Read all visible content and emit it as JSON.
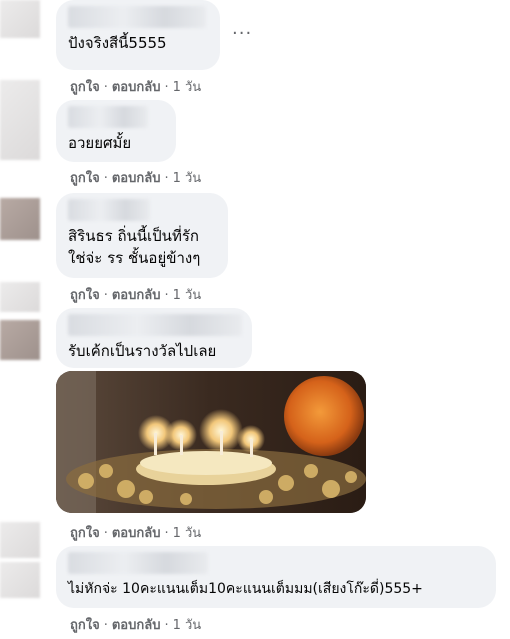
{
  "comments": [
    {
      "text_lines": [
        "ปังจริงสีนี้5555"
      ]
    },
    {
      "text_lines": [
        "อวยยศมั้ย"
      ]
    },
    {
      "text_lines": [
        "สิรินธร ถิ่นนี้เป็นที่รัก",
        "ใช่จ่ะ รร ชั้นอยู่ข้างๆ"
      ]
    },
    {
      "text_lines": [
        "รับเค้กเป็นรางวัลไปเลย"
      ]
    },
    {
      "text_lines": [
        "ไม่หักจ่ะ 10คะแนนเต็ม10คะแนนเต็มมม(เสียงโก๊ะดี่)555+"
      ]
    }
  ],
  "actions": {
    "like": "ถูกใจ",
    "reply": "ตอบกลับ",
    "dot": "·",
    "time": "1 วัน"
  },
  "more_options_symbol": "···",
  "photo_description_icon": "cake-photo"
}
